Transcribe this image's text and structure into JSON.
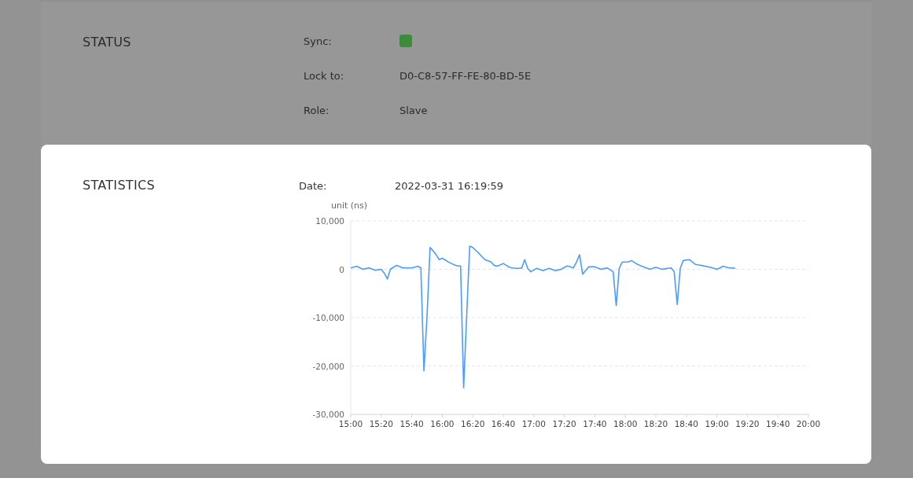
{
  "status": {
    "title": "STATUS",
    "rows": [
      {
        "label": "Sync:",
        "kind": "indicator",
        "color": "#3c8c3c"
      },
      {
        "label": "Lock to:",
        "kind": "text",
        "value": "D0-C8-57-FF-FE-80-BD-5E"
      },
      {
        "label": "Role:",
        "kind": "text",
        "value": "Slave"
      }
    ]
  },
  "statistics": {
    "title": "STATISTICS",
    "date_label": "Date:",
    "date": "2022-03-31 16:19:59",
    "chart_data": {
      "type": "line",
      "ylabel": "unit (ns)",
      "categories": [
        "15:00",
        null,
        null,
        null,
        null,
        null,
        null,
        null,
        null,
        null,
        "15:20",
        null,
        null,
        null,
        null,
        null,
        null,
        null,
        null,
        null,
        "15:40",
        null,
        null,
        null,
        null,
        null,
        null,
        null,
        null,
        null,
        "16:00",
        null,
        null,
        null,
        null,
        null,
        null,
        null,
        null,
        null,
        "16:20",
        null,
        null,
        null,
        null,
        null,
        null,
        null,
        null,
        null,
        "16:40",
        null,
        null,
        null,
        null,
        null,
        null,
        null,
        null,
        null,
        "17:00",
        null,
        null,
        null,
        null,
        null,
        null,
        null,
        null,
        null,
        "17:20",
        null,
        null,
        null,
        null,
        null,
        null,
        null,
        null,
        null,
        "17:40",
        null,
        null,
        null,
        null,
        null,
        null,
        null,
        null,
        null,
        "18:00",
        null,
        null,
        null,
        null,
        null,
        null,
        null,
        null,
        null,
        "18:20",
        null,
        null,
        null,
        null,
        null,
        null,
        null,
        null,
        null,
        "18:40",
        null,
        null,
        null,
        null,
        null,
        null,
        null,
        null,
        null,
        "19:00",
        null,
        null,
        null,
        null,
        null,
        null,
        null,
        null,
        null,
        "19:20",
        null,
        null,
        null,
        null,
        null,
        null,
        null,
        null,
        null,
        "19:40",
        null,
        null,
        null,
        null,
        null,
        null,
        null,
        null,
        null,
        "20:00"
      ],
      "series": [
        {
          "color": "#4a9cff",
          "values": [
            300,
            450,
            600,
            300,
            0,
            150,
            300,
            50,
            -200,
            -100,
            0,
            -800,
            -2000,
            0,
            400,
            800,
            550,
            300,
            300,
            300,
            300,
            450,
            600,
            300,
            -21000,
            -9800,
            4500,
            3800,
            3000,
            2000,
            2300,
            1900,
            1500,
            1200,
            900,
            700,
            700,
            -24500,
            -9800,
            4800,
            4500,
            3900,
            3300,
            2600,
            2000,
            1750,
            1500,
            800,
            650,
            900,
            1200,
            800,
            400,
            300,
            200,
            200,
            200,
            2000,
            200,
            -500,
            -150,
            200,
            -50,
            -300,
            -50,
            200,
            -50,
            -300,
            -150,
            0,
            350,
            700,
            500,
            300,
            1500,
            3000,
            -1000,
            -250,
            500,
            500,
            500,
            250,
            0,
            150,
            300,
            -100,
            -500,
            -7500,
            200,
            1500,
            1500,
            1500,
            1800,
            1400,
            1000,
            750,
            500,
            250,
            0,
            200,
            400,
            200,
            0,
            100,
            200,
            300,
            -500,
            -7300,
            200,
            1800,
            1900,
            2000,
            1500,
            1000,
            900,
            800,
            650,
            500,
            400,
            200,
            0,
            300,
            600,
            450,
            300,
            300,
            200,
            null,
            null,
            null,
            null,
            null,
            null,
            null,
            null,
            null,
            null,
            null,
            null,
            null,
            null,
            null,
            null,
            null,
            null,
            null,
            null,
            null,
            null,
            null,
            null
          ]
        }
      ],
      "ylim": [
        -30000,
        10000
      ],
      "grid": true,
      "yticks": [
        {
          "value": 10000,
          "label": "10,000"
        },
        {
          "value": 0,
          "label": "0"
        },
        {
          "value": -10000,
          "label": "-10,000"
        },
        {
          "value": -20000,
          "label": "-20,000"
        },
        {
          "value": -30000,
          "label": "-30,000"
        }
      ]
    }
  }
}
